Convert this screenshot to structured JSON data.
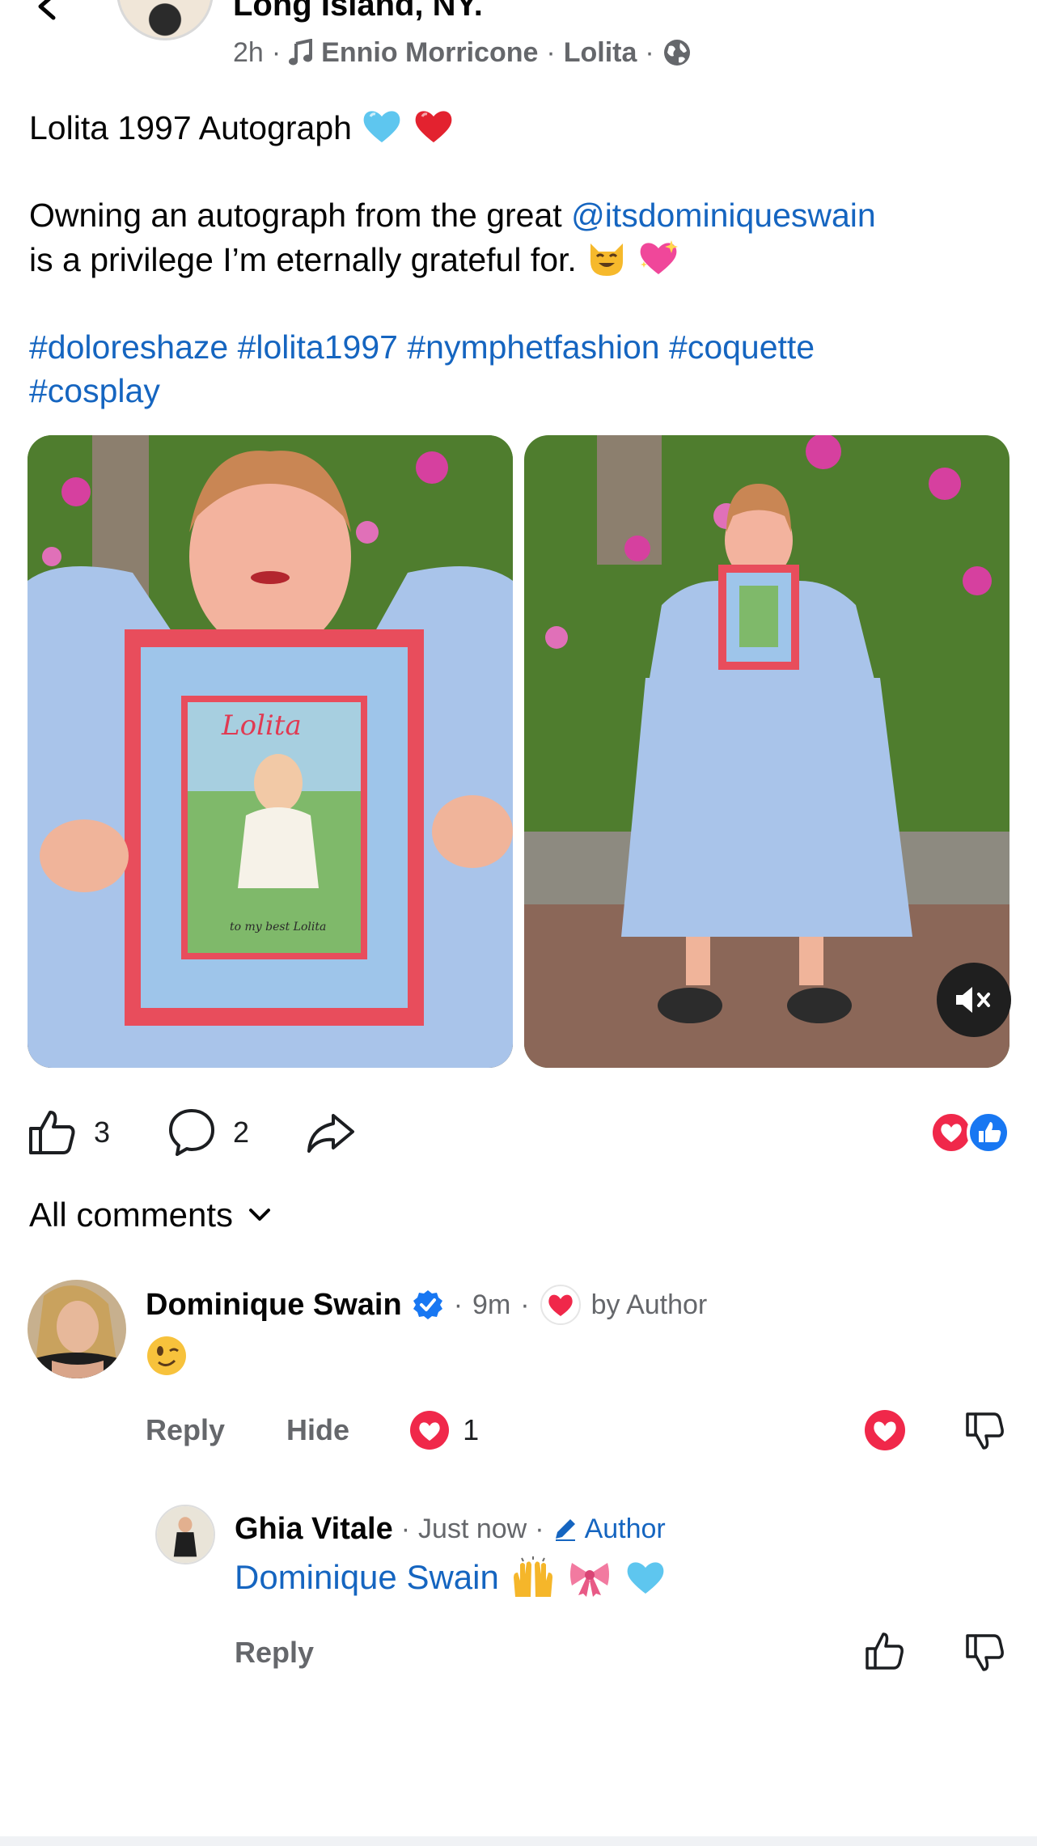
{
  "header": {
    "location": "Long Island, NY.",
    "time": "2h",
    "music_artist": "Ennio Morricone",
    "music_track": "Lolita",
    "icons": [
      "back-arrow-icon",
      "music-note-icon",
      "globe-icon"
    ]
  },
  "post": {
    "title_line": "Lolita 1997 Autograph",
    "body_prefix": "Owning an autograph from the great ",
    "mention": "@itsdominiqueswain",
    "body_suffix": "is a privilege I’m eternally grateful for.",
    "hashtags": [
      "#doloreshaze",
      "#lolita1997",
      "#nymphetfashion",
      "#coquette",
      "#cosplay"
    ],
    "frame_logo": "Lolita",
    "frame_signature": "to my best Lolita"
  },
  "actions": {
    "like_count": "3",
    "comment_count": "2"
  },
  "comments_filter": "All comments",
  "comment1": {
    "name": "Dominique Swain",
    "time": "9m",
    "liked_by": "by Author",
    "reply": "Reply",
    "hide": "Hide",
    "heart_count": "1"
  },
  "reply1": {
    "name": "Ghia Vitale",
    "time": "Just now",
    "badge": "Author",
    "text": "Dominique Swain",
    "reply": "Reply"
  },
  "colors": {
    "link": "#1565c0",
    "heart": "#f0284a",
    "like_blue": "#1877f2",
    "muted": "#65676b"
  }
}
